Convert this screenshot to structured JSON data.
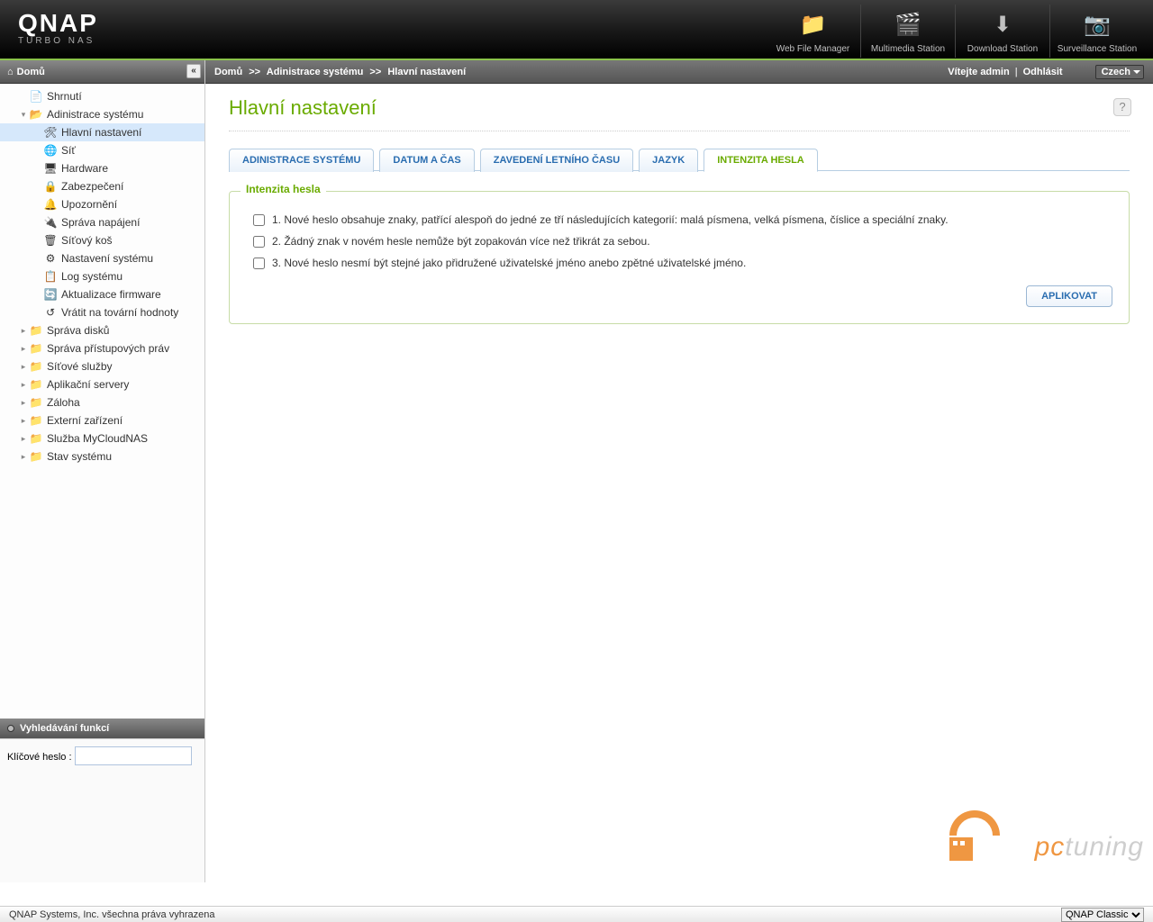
{
  "brand": {
    "name": "QNAP",
    "sub": "TURBO NAS"
  },
  "header_apps": [
    {
      "label": "Web File Manager",
      "icon": "📁"
    },
    {
      "label": "Multimedia Station",
      "icon": "🎬"
    },
    {
      "label": "Download Station",
      "icon": "⬇"
    },
    {
      "label": "Surveillance Station",
      "icon": "📷"
    }
  ],
  "sidebar": {
    "title": "Domů",
    "home_icon": "⌂",
    "items": [
      {
        "label": "Shrnutí",
        "icon": "📄",
        "depth": 1,
        "toggle": ""
      },
      {
        "label": "Adinistrace systému",
        "icon": "📂",
        "depth": 1,
        "toggle": "▾",
        "open": true
      },
      {
        "label": "Hlavní nastavení",
        "icon": "🛠",
        "depth": 2,
        "toggle": "",
        "selected": true
      },
      {
        "label": "Síť",
        "icon": "🌐",
        "depth": 2,
        "toggle": ""
      },
      {
        "label": "Hardware",
        "icon": "🖥",
        "depth": 2,
        "toggle": ""
      },
      {
        "label": "Zabezpečení",
        "icon": "🔒",
        "depth": 2,
        "toggle": ""
      },
      {
        "label": "Upozornění",
        "icon": "🔔",
        "depth": 2,
        "toggle": ""
      },
      {
        "label": "Správa napájení",
        "icon": "🔌",
        "depth": 2,
        "toggle": ""
      },
      {
        "label": "Síťový koš",
        "icon": "🗑",
        "depth": 2,
        "toggle": ""
      },
      {
        "label": "Nastavení systému",
        "icon": "⚙",
        "depth": 2,
        "toggle": ""
      },
      {
        "label": "Log systému",
        "icon": "📋",
        "depth": 2,
        "toggle": ""
      },
      {
        "label": "Aktualizace firmware",
        "icon": "🔄",
        "depth": 2,
        "toggle": ""
      },
      {
        "label": "Vrátit na tovární hodnoty",
        "icon": "↺",
        "depth": 2,
        "toggle": ""
      },
      {
        "label": "Správa disků",
        "icon": "📁",
        "depth": 1,
        "toggle": "▸"
      },
      {
        "label": "Správa přístupových práv",
        "icon": "📁",
        "depth": 1,
        "toggle": "▸"
      },
      {
        "label": "Síťové služby",
        "icon": "📁",
        "depth": 1,
        "toggle": "▸"
      },
      {
        "label": "Aplikační servery",
        "icon": "📁",
        "depth": 1,
        "toggle": "▸"
      },
      {
        "label": "Záloha",
        "icon": "📁",
        "depth": 1,
        "toggle": "▸"
      },
      {
        "label": "Externí zařízení",
        "icon": "📁",
        "depth": 1,
        "toggle": "▸"
      },
      {
        "label": "Služba MyCloudNAS",
        "icon": "📁",
        "depth": 1,
        "toggle": "▸"
      },
      {
        "label": "Stav systému",
        "icon": "📁",
        "depth": 1,
        "toggle": "▸"
      }
    ],
    "search_title": "Vyhledávání funkcí",
    "search_label": "Klíčové heslo :"
  },
  "breadcrumb": {
    "parts": [
      "Domů",
      "Adinistrace systému",
      "Hlavní nastavení"
    ],
    "sep": ">>",
    "welcome": "Vítejte admin",
    "logout": "Odhlásit",
    "lang": "Czech"
  },
  "main": {
    "title": "Hlavní nastavení",
    "tabs": [
      {
        "label": "ADINISTRACE SYSTÉMU",
        "active": false
      },
      {
        "label": "DATUM A ČAS",
        "active": false
      },
      {
        "label": "ZAVEDENÍ LETNÍHO ČASU",
        "active": false
      },
      {
        "label": "JAZYK",
        "active": false
      },
      {
        "label": "INTENZITA HESLA",
        "active": true
      }
    ],
    "fieldset_legend": "Intenzita hesla",
    "rules": [
      "1. Nové heslo obsahuje znaky, patřící alespoň do jedné ze tří následujících kategorií: malá písmena, velká písmena, číslice a speciální znaky.",
      "2. Žádný znak v novém hesle nemůže být zopakován více než třikrát za sebou.",
      "3. Nové heslo nesmí být stejné jako přidružené uživatelské jméno anebo zpětné uživatelské jméno."
    ],
    "apply": "APLIKOVAT"
  },
  "footer": {
    "copyright": "QNAP Systems, Inc. všechna práva vyhrazena",
    "theme": "QNAP Classic"
  },
  "watermark": {
    "t1": "pc",
    "t2": "tuning"
  }
}
